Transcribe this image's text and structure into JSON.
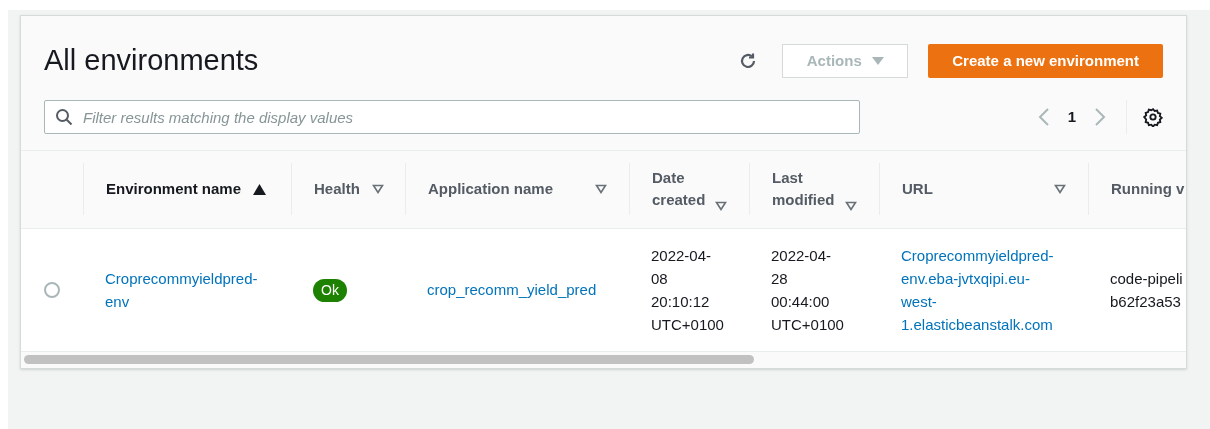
{
  "title": "All environments",
  "toolbar": {
    "actions": {
      "label": "Actions",
      "disabled": true
    },
    "create_button": "Create a new environment"
  },
  "filter": {
    "placeholder": "Filter results matching the display values"
  },
  "pagination": {
    "page": "1",
    "prev_disabled": true,
    "next_disabled": true
  },
  "table": {
    "columns": [
      {
        "label": "Environment name",
        "sortable": true,
        "sorted": true
      },
      {
        "label": "Health",
        "sortable": true,
        "sorted": false
      },
      {
        "label": "Application name",
        "sortable": true,
        "sorted": false
      },
      {
        "label": "Date created",
        "sortable": true,
        "sorted": false
      },
      {
        "label": "Last modified",
        "sortable": true,
        "sorted": false
      },
      {
        "label": "URL",
        "sortable": true,
        "sorted": false
      },
      {
        "label": "Running v"
      }
    ],
    "rows": [
      {
        "selected": false,
        "environment_name": "Croprecommyieldpred-env",
        "health": {
          "label": "Ok",
          "color": "#1d8102"
        },
        "application_name": "crop_recomm_yield_pred",
        "date_created": "2022-04-08 20:10:12 UTC+0100",
        "last_modified": "2022-04-28 00:44:00 UTC+0100",
        "url": "Croprecommyieldpred-env.eba-jvtxqipi.eu-west-1.elasticbeanstalk.com",
        "running_version": "code-pipeli b62f23a53"
      }
    ]
  }
}
